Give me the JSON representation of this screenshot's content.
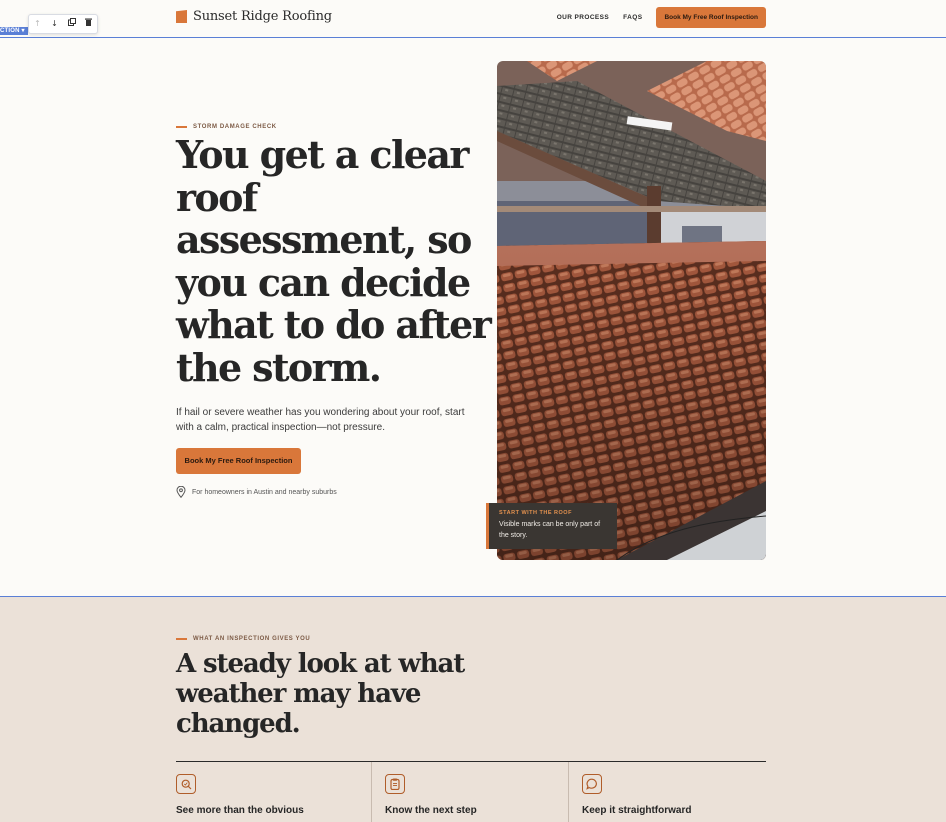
{
  "editor": {
    "section_tag": "CTION ▾",
    "tools": [
      {
        "name": "move-up-icon",
        "glyph": "↑"
      },
      {
        "name": "move-down-icon",
        "glyph": "↓"
      },
      {
        "name": "duplicate-icon",
        "glyph": "⧉"
      },
      {
        "name": "delete-icon",
        "glyph": "🗑"
      }
    ]
  },
  "header": {
    "brand": "Sunset Ridge Roofing",
    "nav": [
      "OUR PROCESS",
      "FAQS"
    ],
    "cta": "Book My Free Roof Inspection"
  },
  "hero": {
    "eyebrow": "STORM DAMAGE CHECK",
    "title": "You get a clear roof assessment, so you can decide what to do after the storm.",
    "text": "If hail or severe weather has you wondering about your roof, start with a calm, practical inspection—not pressure.",
    "cta": "Book My Free Roof Inspection",
    "location": "For homeowners in Austin and nearby suburbs",
    "caption": {
      "heading": "START WITH THE ROOF",
      "body": "Visible marks can be only part of the story."
    }
  },
  "benefits": {
    "eyebrow": "WHAT AN INSPECTION GIVES YOU",
    "title": "A steady look at what weather may have changed.",
    "items": [
      {
        "title": "See more than the obvious",
        "icon": "search-icon"
      },
      {
        "title": "Know the next step",
        "icon": "clipboard-icon"
      },
      {
        "title": "Keep it straightforward",
        "icon": "chat-icon"
      }
    ]
  },
  "colors": {
    "accent": "#d9773a",
    "background": "#fcfbf8",
    "section_bg": "#ebe1d8",
    "text": "#262626",
    "selection": "#5a7fd6"
  }
}
